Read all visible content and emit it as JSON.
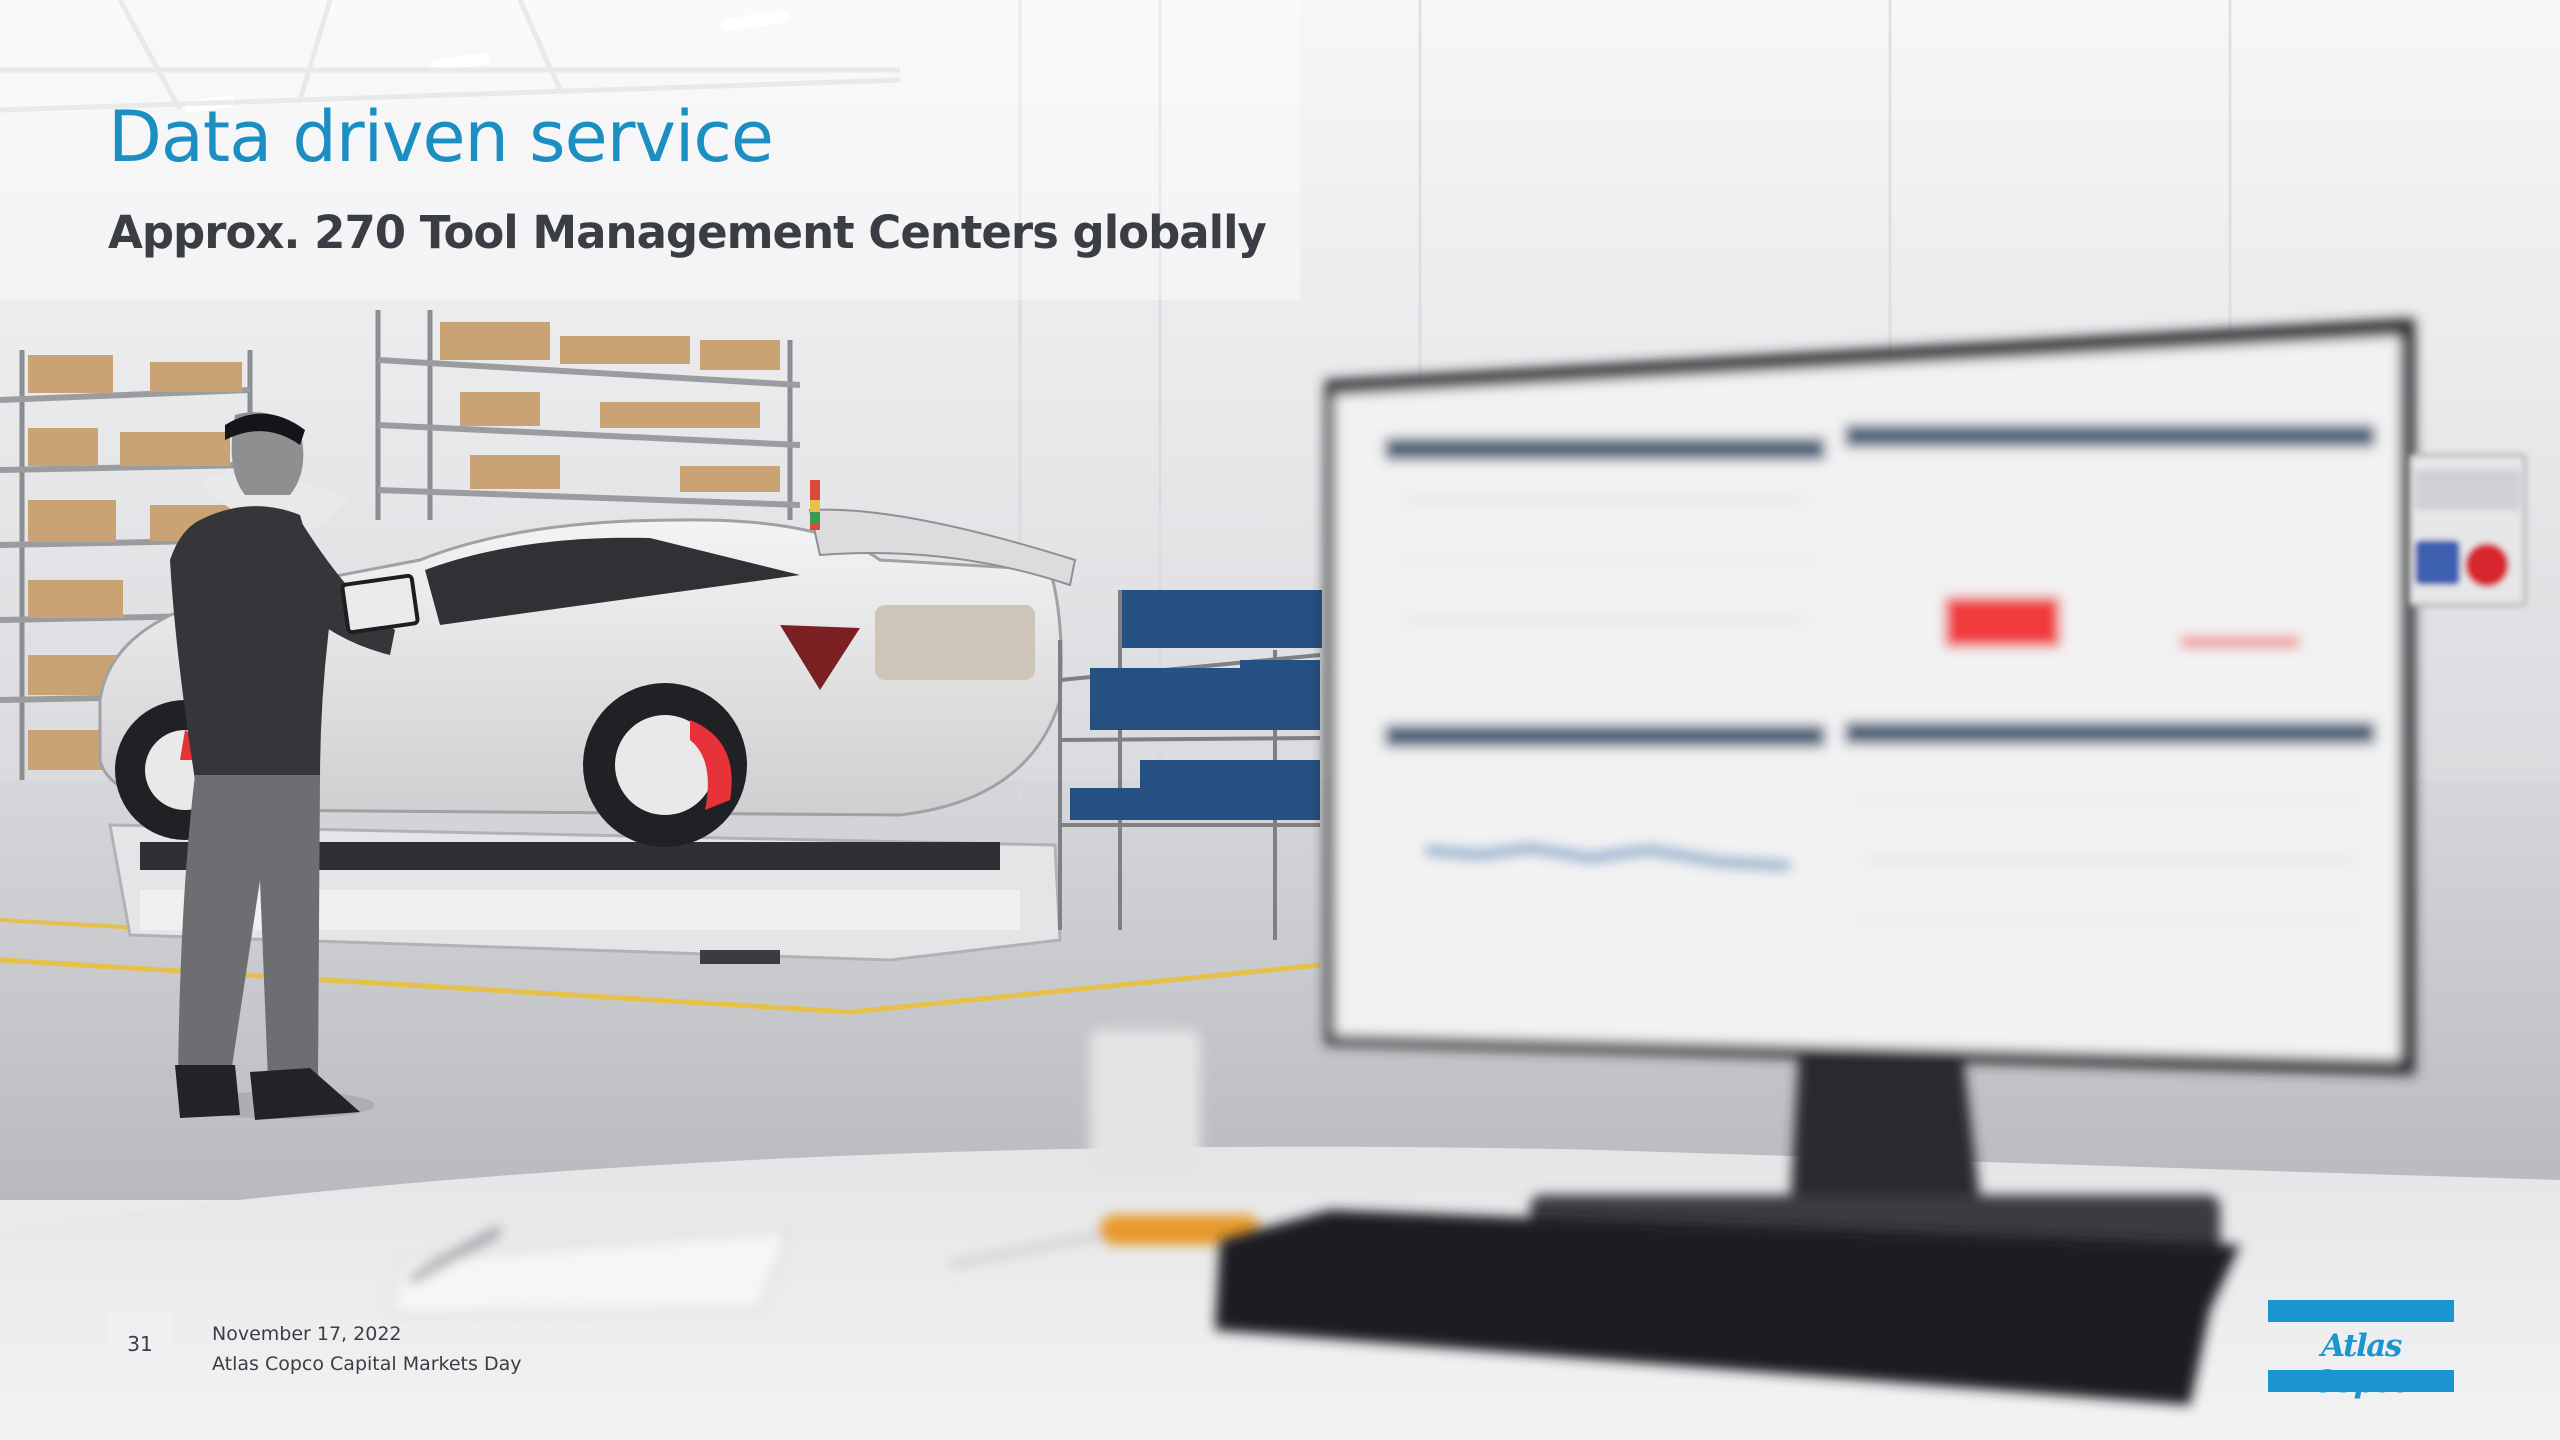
{
  "slide": {
    "title": "Data driven service",
    "subtitle": "Approx. 270 Tool Management Centers globally",
    "page_number": "31",
    "footer_date": "November 17, 2022",
    "footer_event": "Atlas Copco Capital Markets Day"
  },
  "logo": {
    "text": "Atlas Copco",
    "color": "#1b95cf"
  },
  "colors": {
    "title": "#1b8fc2",
    "subtitle": "#3a3e44",
    "accent_red": "#e8323a",
    "floor_line": "#e6c14a"
  }
}
